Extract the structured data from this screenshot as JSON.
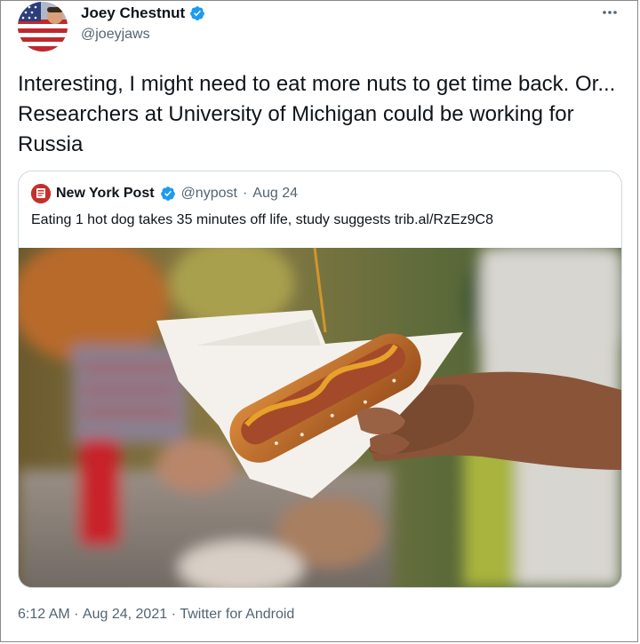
{
  "author": {
    "name": "Joey Chestnut",
    "handle": "@joeyjaws"
  },
  "more_icon": "more-horizontal-icon",
  "tweet": {
    "text": "Interesting, I might need to eat more nuts to get time back. Or... Researchers at University of Michigan could be working for Russia"
  },
  "quote": {
    "name": "New York Post",
    "handle": "@nypost",
    "separator": "·",
    "date": "Aug 24",
    "text": "Eating 1 hot dog takes 35 minutes off life, study suggests trib.al/RzEz9C8"
  },
  "meta": {
    "time": "6:12 AM",
    "sep1": " · ",
    "date": "Aug 24, 2021",
    "sep2": " · ",
    "source": "Twitter for Android"
  },
  "colors": {
    "verified": "#1d9bf0",
    "secondary_text": "#536471",
    "nypost_red": "#c4302b"
  }
}
